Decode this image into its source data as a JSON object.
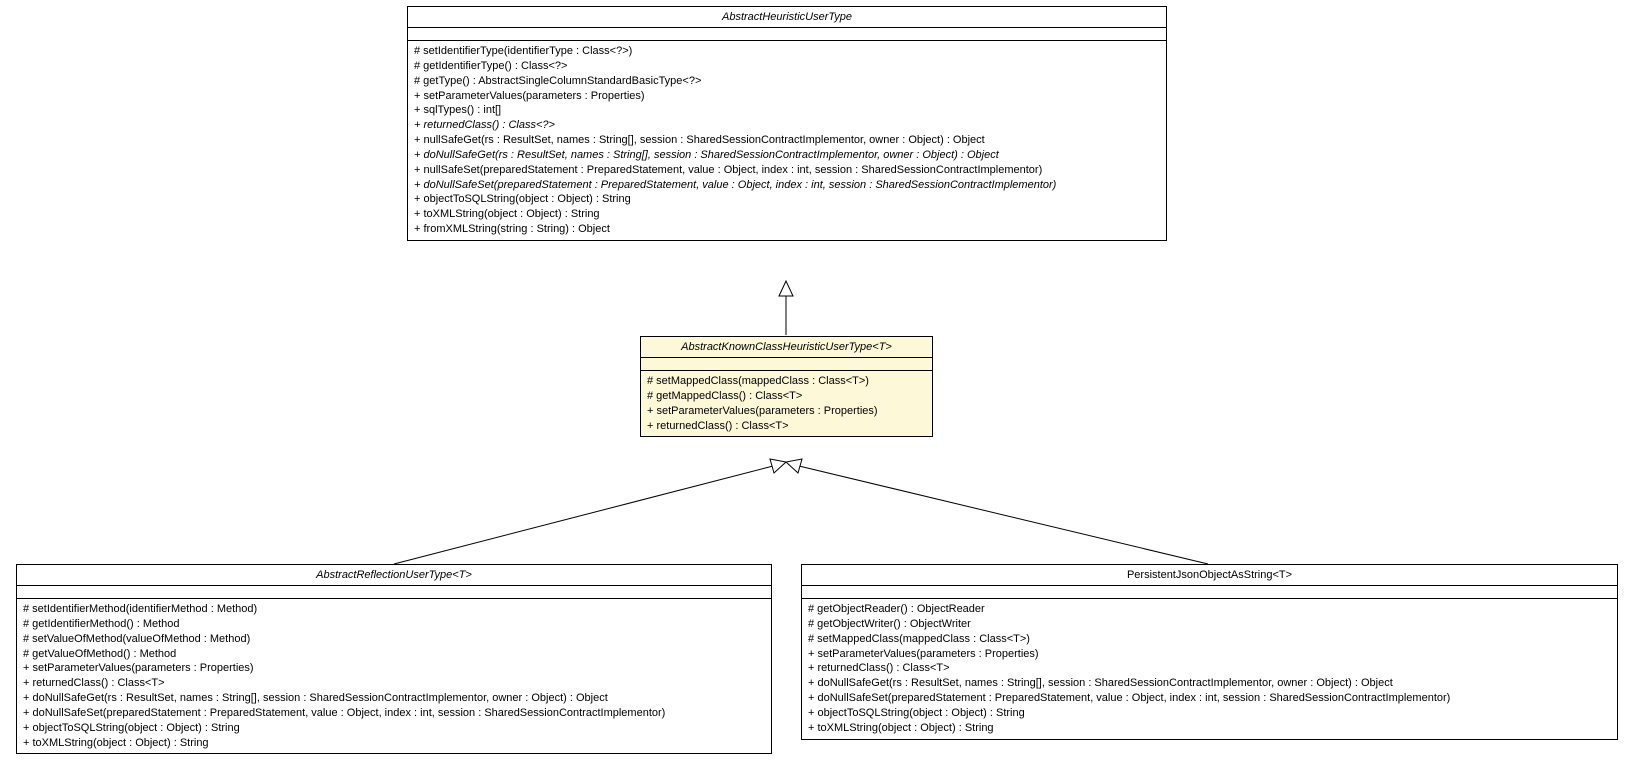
{
  "classes": {
    "abstractHeuristicUserType": {
      "name": "AbstractHeuristicUserType",
      "abstract": true,
      "methods": [
        {
          "text": "# setIdentifierType(identifierType : Class<?>)",
          "abstract": false
        },
        {
          "text": "# getIdentifierType() : Class<?>",
          "abstract": false
        },
        {
          "text": "# getType() : AbstractSingleColumnStandardBasicType<?>",
          "abstract": false
        },
        {
          "text": "+ setParameterValues(parameters : Properties)",
          "abstract": false
        },
        {
          "text": "+ sqlTypes() : int[]",
          "abstract": false
        },
        {
          "text": "+ returnedClass() : Class<?>",
          "abstract": true
        },
        {
          "text": "+ nullSafeGet(rs : ResultSet, names : String[], session : SharedSessionContractImplementor, owner : Object) : Object",
          "abstract": false
        },
        {
          "text": "+ doNullSafeGet(rs : ResultSet, names : String[], session : SharedSessionContractImplementor, owner : Object) : Object",
          "abstract": true
        },
        {
          "text": "+ nullSafeSet(preparedStatement : PreparedStatement, value : Object, index : int, session : SharedSessionContractImplementor)",
          "abstract": false
        },
        {
          "text": "+ doNullSafeSet(preparedStatement : PreparedStatement, value : Object, index : int, session : SharedSessionContractImplementor)",
          "abstract": true
        },
        {
          "text": "+ objectToSQLString(object : Object) : String",
          "abstract": false
        },
        {
          "text": "+ toXMLString(object : Object) : String",
          "abstract": false
        },
        {
          "text": "+ fromXMLString(string : String) : Object",
          "abstract": false
        }
      ]
    },
    "abstractKnownClassHeuristicUserType": {
      "name": "AbstractKnownClassHeuristicUserType<T>",
      "abstract": true,
      "methods": [
        {
          "text": "# setMappedClass(mappedClass : Class<T>)",
          "abstract": false
        },
        {
          "text": "# getMappedClass() : Class<T>",
          "abstract": false
        },
        {
          "text": "+ setParameterValues(parameters : Properties)",
          "abstract": false
        },
        {
          "text": "+ returnedClass() : Class<T>",
          "abstract": false
        }
      ]
    },
    "abstractReflectionUserType": {
      "name": "AbstractReflectionUserType<T>",
      "abstract": true,
      "methods": [
        {
          "text": "# setIdentifierMethod(identifierMethod : Method)",
          "abstract": false
        },
        {
          "text": "# getIdentifierMethod() : Method",
          "abstract": false
        },
        {
          "text": "# setValueOfMethod(valueOfMethod : Method)",
          "abstract": false
        },
        {
          "text": "# getValueOfMethod() : Method",
          "abstract": false
        },
        {
          "text": "+ setParameterValues(parameters : Properties)",
          "abstract": false
        },
        {
          "text": "+ returnedClass() : Class<T>",
          "abstract": false
        },
        {
          "text": "+ doNullSafeGet(rs : ResultSet, names : String[], session : SharedSessionContractImplementor, owner : Object) : Object",
          "abstract": false
        },
        {
          "text": "+ doNullSafeSet(preparedStatement : PreparedStatement, value : Object, index : int, session : SharedSessionContractImplementor)",
          "abstract": false
        },
        {
          "text": "+ objectToSQLString(object : Object) : String",
          "abstract": false
        },
        {
          "text": "+ toXMLString(object : Object) : String",
          "abstract": false
        }
      ]
    },
    "persistentJsonObjectAsString": {
      "name": "PersistentJsonObjectAsString<T>",
      "abstract": false,
      "methods": [
        {
          "text": "# getObjectReader() : ObjectReader",
          "abstract": false
        },
        {
          "text": "# getObjectWriter() : ObjectWriter",
          "abstract": false
        },
        {
          "text": "# setMappedClass(mappedClass : Class<T>)",
          "abstract": false
        },
        {
          "text": "+ setParameterValues(parameters : Properties)",
          "abstract": false
        },
        {
          "text": "+ returnedClass() : Class<T>",
          "abstract": false
        },
        {
          "text": "+ doNullSafeGet(rs : ResultSet, names : String[], session : SharedSessionContractImplementor, owner : Object) : Object",
          "abstract": false
        },
        {
          "text": "+ doNullSafeSet(preparedStatement : PreparedStatement, value : Object, index : int, session : SharedSessionContractImplementor)",
          "abstract": false
        },
        {
          "text": "+ objectToSQLString(object : Object) : String",
          "abstract": false
        },
        {
          "text": "+ toXMLString(object : Object) : String",
          "abstract": false
        }
      ]
    }
  }
}
